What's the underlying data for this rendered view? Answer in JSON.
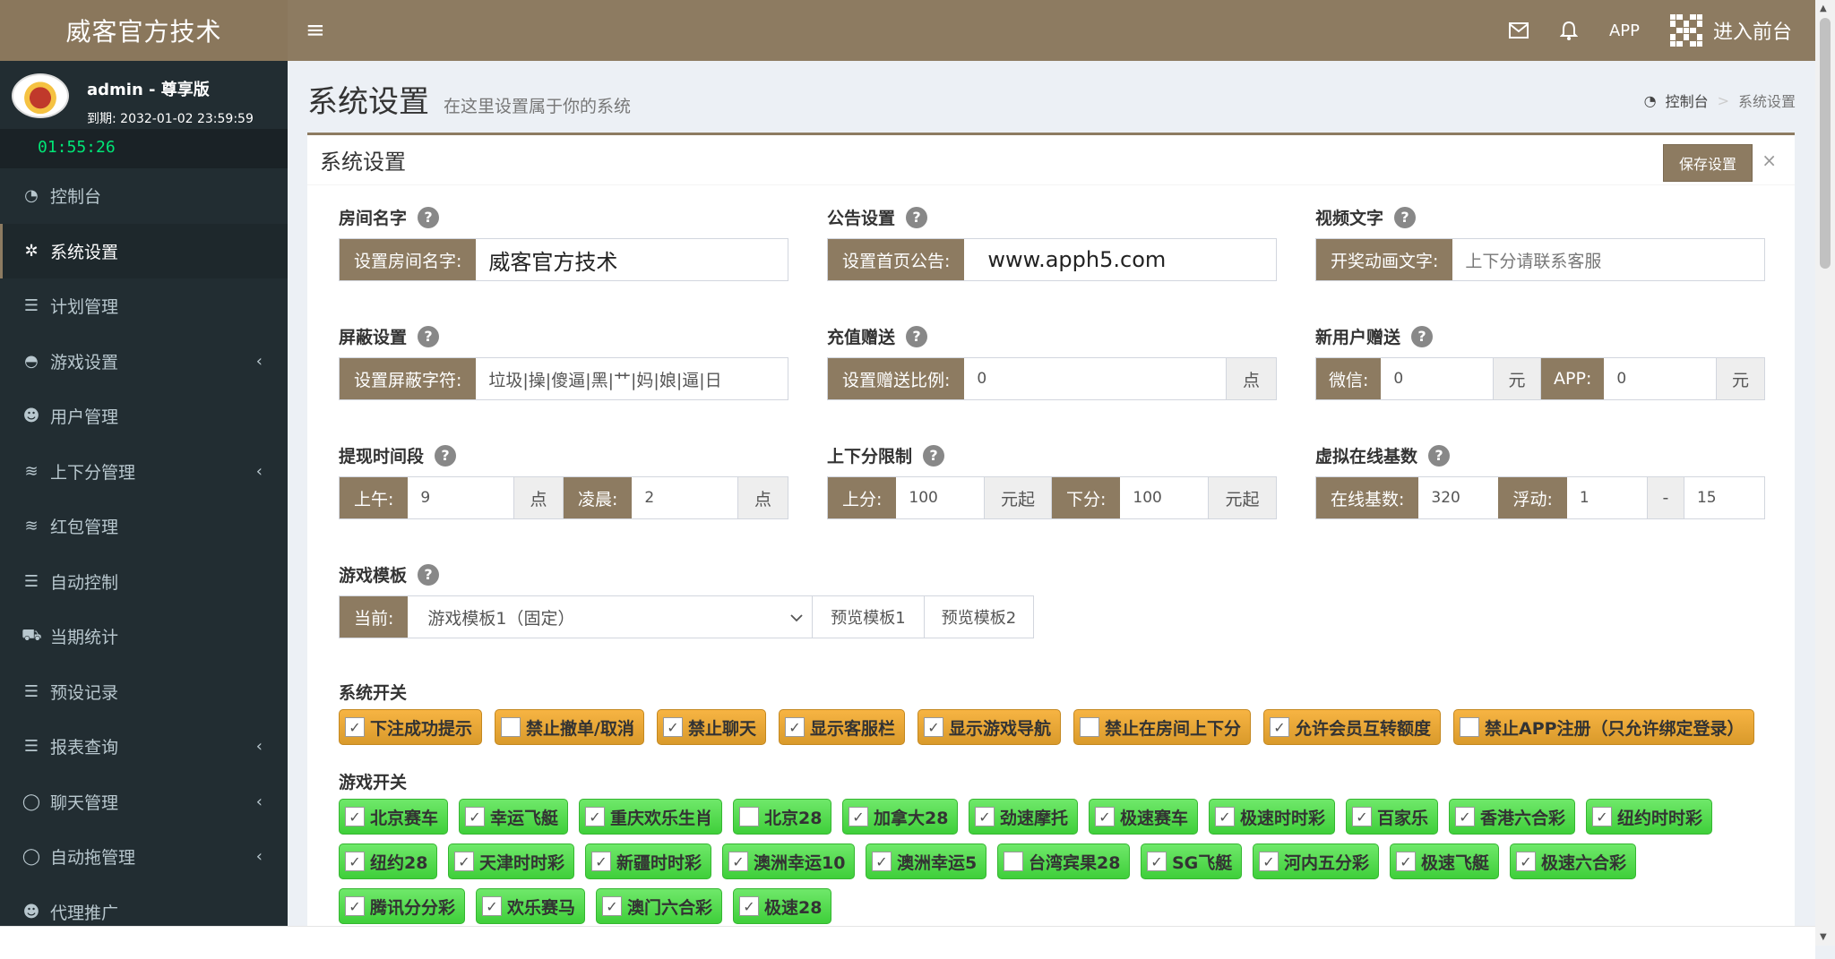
{
  "header": {
    "logo": "威客官方技术",
    "menu_toggle": "≡",
    "app_label": "APP",
    "enter_front": "进入前台"
  },
  "sidebar": {
    "user": {
      "name": "admin - 尊享版",
      "expire": "到期: 2032-01-02 23:59:59",
      "clock": "01:55:26"
    },
    "items": [
      {
        "label": "控制台",
        "icon": "dashboard-icon",
        "glyph": "◔",
        "chevron": false,
        "active": false
      },
      {
        "label": "系统设置",
        "icon": "gears-icon",
        "glyph": "✲",
        "chevron": false,
        "active": true
      },
      {
        "label": "计划管理",
        "icon": "list-icon",
        "glyph": "☰",
        "chevron": false,
        "active": false
      },
      {
        "label": "游戏设置",
        "icon": "gamepad-icon",
        "glyph": "◓",
        "chevron": true,
        "active": false
      },
      {
        "label": "用户管理",
        "icon": "users-icon",
        "glyph": "☻",
        "chevron": false,
        "active": false
      },
      {
        "label": "上下分管理",
        "icon": "database-icon",
        "glyph": "≋",
        "chevron": true,
        "active": false
      },
      {
        "label": "红包管理",
        "icon": "database-icon",
        "glyph": "≋",
        "chevron": false,
        "active": false
      },
      {
        "label": "自动控制",
        "icon": "list-icon",
        "glyph": "☰",
        "chevron": false,
        "active": false
      },
      {
        "label": "当期统计",
        "icon": "cart-icon",
        "glyph": "⛟",
        "chevron": false,
        "active": false
      },
      {
        "label": "预设记录",
        "icon": "list-icon",
        "glyph": "☰",
        "chevron": false,
        "active": false
      },
      {
        "label": "报表查询",
        "icon": "list-icon",
        "glyph": "☰",
        "chevron": true,
        "active": false
      },
      {
        "label": "聊天管理",
        "icon": "comment-icon",
        "glyph": "◯",
        "chevron": true,
        "active": false
      },
      {
        "label": "自动拖管理",
        "icon": "comment-dots-icon",
        "glyph": "◯",
        "chevron": true,
        "active": false
      },
      {
        "label": "代理推广",
        "icon": "user-plus-icon",
        "glyph": "☻",
        "chevron": false,
        "active": false
      }
    ]
  },
  "page": {
    "title": "系统设置",
    "subtitle": "在这里设置属于你的系统",
    "breadcrumb": {
      "home": "控制台",
      "sep": ">",
      "current": "系统设置"
    }
  },
  "box": {
    "title": "系统设置",
    "save": "保存设置",
    "close": "×"
  },
  "form": {
    "room_name": {
      "label": "房间名字",
      "addon": "设置房间名字:",
      "value": "威客官方技术"
    },
    "notice": {
      "label": "公告设置",
      "addon": "设置首页公告:",
      "value": "www.apph5.com"
    },
    "video_text": {
      "label": "视频文字",
      "addon": "开奖动画文字:",
      "placeholder": "上下分请联系客服"
    },
    "block": {
      "label": "屏蔽设置",
      "addon": "设置屏蔽字符:",
      "value": "垃圾|操|傻逼|黑|艹|妈|娘|逼|日"
    },
    "recharge_bonus": {
      "label": "充值赠送",
      "addon": "设置赠送比例:",
      "value": "0",
      "unit": "点"
    },
    "new_user_bonus": {
      "label": "新用户赠送",
      "wechat_addon": "微信:",
      "wechat_value": "0",
      "unit1": "元",
      "app_addon": "APP:",
      "app_value": "0",
      "unit2": "元"
    },
    "withdraw_time": {
      "label": "提现时间段",
      "am_addon": "上午:",
      "am_value": "9",
      "unit1": "点",
      "early_addon": "凌晨:",
      "early_value": "2",
      "unit2": "点"
    },
    "score_limit": {
      "label": "上下分限制",
      "up_addon": "上分:",
      "up_value": "100",
      "unit1": "元起",
      "down_addon": "下分:",
      "down_value": "100",
      "unit2": "元起"
    },
    "online_base": {
      "label": "虚拟在线基数",
      "base_addon": "在线基数:",
      "base_value": "320",
      "float_addon": "浮动:",
      "float_min": "1",
      "dash": "-",
      "float_max": "15"
    },
    "game_template": {
      "label": "游戏模板",
      "addon": "当前:",
      "selected": "游戏模板1（固定）",
      "preview1": "预览模板1",
      "preview2": "预览模板2"
    }
  },
  "system_switches": {
    "title": "系统开关",
    "items": [
      {
        "label": "下注成功提示",
        "checked": true
      },
      {
        "label": "禁止撤单/取消",
        "checked": false
      },
      {
        "label": "禁止聊天",
        "checked": true
      },
      {
        "label": "显示客服栏",
        "checked": true
      },
      {
        "label": "显示游戏导航",
        "checked": true
      },
      {
        "label": "禁止在房间上下分",
        "checked": false
      },
      {
        "label": "允许会员互转额度",
        "checked": true
      },
      {
        "label": "禁止APP注册（只允许绑定登录）",
        "checked": false
      }
    ]
  },
  "game_switches": {
    "title": "游戏开关",
    "items": [
      {
        "label": "北京赛车",
        "checked": true
      },
      {
        "label": "幸运飞艇",
        "checked": true
      },
      {
        "label": "重庆欢乐生肖",
        "checked": true
      },
      {
        "label": "北京28",
        "checked": false
      },
      {
        "label": "加拿大28",
        "checked": true
      },
      {
        "label": "劲速摩托",
        "checked": true
      },
      {
        "label": "极速赛车",
        "checked": true
      },
      {
        "label": "极速时时彩",
        "checked": true
      },
      {
        "label": "百家乐",
        "checked": true
      },
      {
        "label": "香港六合彩",
        "checked": true
      },
      {
        "label": "纽约时时彩",
        "checked": true
      },
      {
        "label": "纽约28",
        "checked": true
      },
      {
        "label": "天津时时彩",
        "checked": true
      },
      {
        "label": "新疆时时彩",
        "checked": true
      },
      {
        "label": "澳洲幸运10",
        "checked": true
      },
      {
        "label": "澳洲幸运5",
        "checked": true
      },
      {
        "label": "台湾宾果28",
        "checked": false
      },
      {
        "label": "SG飞艇",
        "checked": true
      },
      {
        "label": "河内五分彩",
        "checked": true
      },
      {
        "label": "极速飞艇",
        "checked": true
      },
      {
        "label": "极速六合彩",
        "checked": true
      },
      {
        "label": "腾讯分分彩",
        "checked": true
      },
      {
        "label": "欢乐赛马",
        "checked": true
      },
      {
        "label": "澳门六合彩",
        "checked": true
      },
      {
        "label": "极速28",
        "checked": true
      }
    ]
  },
  "colors": {
    "brand": "#8d7b61",
    "sidebar": "#222d32",
    "orange_chip": "#f0ad3e",
    "green_chip": "#4cd946",
    "clock": "#00e676"
  }
}
